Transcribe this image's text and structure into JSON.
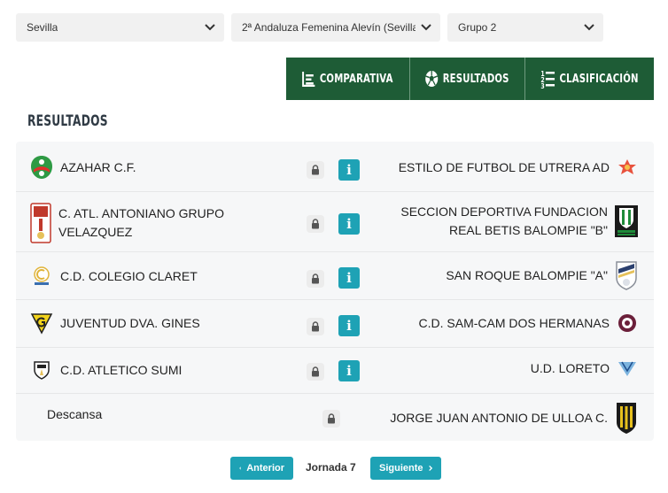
{
  "filters": {
    "province": "Sevilla",
    "competition": "2ª Andaluza Femenina Alevín (Sevilla)",
    "group": "Grupo 2"
  },
  "tabs": {
    "comparativa": "COMPARATIVA",
    "resultados": "RESULTADOS",
    "clasificacion": "CLASIFICACIÓN"
  },
  "section_title": "RESULTADOS",
  "matches": [
    {
      "home": "AZAHAR C.F.",
      "away": "ESTILO DE FUTBOL DE UTRERA AD",
      "home_crest": "azahar-crest-icon",
      "away_crest": "estilo-utrera-crest-icon"
    },
    {
      "home_line1": "C. ATL. ANTONIANO GRUPO",
      "home_line2": "VELAZQUEZ",
      "away_line1": "SECCION DEPORTIVA FUNDACION",
      "away_line2": "REAL BETIS BALOMPIE \"B\"",
      "home_crest": "antoniano-crest-icon",
      "away_crest": "betis-crest-icon"
    },
    {
      "home": "C.D. COLEGIO CLARET",
      "away": "SAN ROQUE BALOMPIE \"A\"",
      "home_crest": "claret-crest-icon",
      "away_crest": "san-roque-crest-icon"
    },
    {
      "home": "JUVENTUD DVA. GINES",
      "away": "C.D. SAM-CAM DOS HERMANAS",
      "home_crest": "gines-crest-icon",
      "away_crest": "sam-cam-crest-icon"
    },
    {
      "home": "C.D. ATLETICO SUMI",
      "away": "U.D. LORETO",
      "home_crest": "sumi-crest-icon",
      "away_crest": "loreto-crest-icon"
    }
  ],
  "bye": {
    "label": "Descansa",
    "team": "JORGE JUAN ANTONIO DE ULLOA C.",
    "crest": "ulloa-crest-icon"
  },
  "info_label": "i",
  "pager": {
    "prev": "Anterior",
    "current": "Jornada 7",
    "next": "Siguiente"
  },
  "colors": {
    "brand_green": "#1e5c36",
    "accent_teal": "#1ea2b5"
  }
}
